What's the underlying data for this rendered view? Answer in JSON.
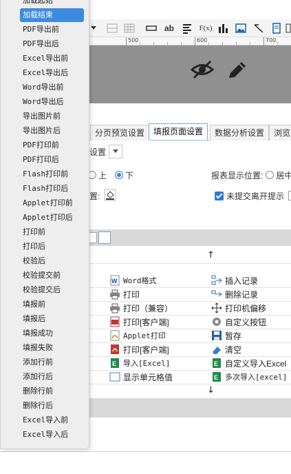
{
  "dropdown": {
    "items": [
      {
        "label": "加载起始",
        "selected": false
      },
      {
        "label": "加载结束",
        "selected": true
      },
      {
        "label": "PDF导出前",
        "selected": false
      },
      {
        "label": "PDF导出后",
        "selected": false
      },
      {
        "label": "Excel导出前",
        "selected": false
      },
      {
        "label": "Excel导出后",
        "selected": false
      },
      {
        "label": "Word导出前",
        "selected": false
      },
      {
        "label": "Word导出后",
        "selected": false
      },
      {
        "label": "导出图片前",
        "selected": false
      },
      {
        "label": "导出图片后",
        "selected": false
      },
      {
        "label": "PDF打印前",
        "selected": false
      },
      {
        "label": "PDF打印后",
        "selected": false
      },
      {
        "label": "Flash打印前",
        "selected": false
      },
      {
        "label": "Flash打印后",
        "selected": false
      },
      {
        "label": "Applet打印前",
        "selected": false
      },
      {
        "label": "Applet打印后",
        "selected": false
      },
      {
        "label": "打印前",
        "selected": false
      },
      {
        "label": "打印后",
        "selected": false
      },
      {
        "label": "校验后",
        "selected": false
      },
      {
        "label": "校验提交前",
        "selected": false
      },
      {
        "label": "校验提交后",
        "selected": false
      },
      {
        "label": "填报前",
        "selected": false
      },
      {
        "label": "填报后",
        "selected": false
      },
      {
        "label": "填报成功",
        "selected": false
      },
      {
        "label": "填报失败",
        "selected": false
      },
      {
        "label": "添加行前",
        "selected": false
      },
      {
        "label": "添加行后",
        "selected": false
      },
      {
        "label": "删除行前",
        "selected": false
      },
      {
        "label": "删除行后",
        "selected": false
      },
      {
        "label": "Excel导入前",
        "selected": false
      },
      {
        "label": "Excel导入后",
        "selected": false
      }
    ]
  },
  "toolbar": {
    "text_ab": "ab",
    "fx": "F(x)"
  },
  "ruler": {
    "labels": [
      "500",
      "600",
      "700"
    ]
  },
  "tabs": [
    {
      "label": "分页预览设置",
      "active": false
    },
    {
      "label": "填报页面设置",
      "active": true
    },
    {
      "label": "数据分析设置",
      "active": false
    },
    {
      "label": "浏览",
      "active": false
    }
  ],
  "settings": {
    "partial_label": "设置",
    "position_top": "上",
    "position_bottom": "下",
    "report_position_label": "报表显示位置:",
    "report_position_center": "居中",
    "partial_label_2": "置:",
    "unsubmitted_label": "未提交离开提示"
  },
  "arrows": {
    "up": "↑",
    "down": "↓"
  },
  "buttons": {
    "col1": [
      {
        "label": "Word格式",
        "icon": "word-icon"
      },
      {
        "label": "打印",
        "icon": "printer-icon"
      },
      {
        "label": "打印（兼容）",
        "icon": "printer-compat-icon"
      },
      {
        "label": "打印[客户端]",
        "icon": "flash-print-icon"
      },
      {
        "label": "Applet打印",
        "icon": "applet-icon"
      },
      {
        "label": "打印[客户端]",
        "icon": "pdf-print-icon"
      },
      {
        "label": "导入[Excel]",
        "icon": "excel-import-icon"
      },
      {
        "label": "显示单元格值",
        "icon": "cell-value-icon"
      }
    ],
    "col2": [
      {
        "label": "插入记录",
        "icon": "insert-record-icon"
      },
      {
        "label": "删除记录",
        "icon": "delete-record-icon"
      },
      {
        "label": "打印机偏移",
        "icon": "move-icon"
      },
      {
        "label": "自定义按钮",
        "icon": "gear-icon"
      },
      {
        "label": "暂存",
        "icon": "save-icon"
      },
      {
        "label": "清空",
        "icon": "eraser-icon"
      },
      {
        "label": "自定义导入Excel",
        "icon": "custom-excel-icon"
      },
      {
        "label": "多次导入[excel]",
        "icon": "multi-excel-icon"
      }
    ]
  },
  "colors": {
    "selected_bg": "#3d8be0",
    "canvas_gray": "#909090",
    "tab_border": "#7ca7d6",
    "checkbox": "#2f7ad1"
  }
}
